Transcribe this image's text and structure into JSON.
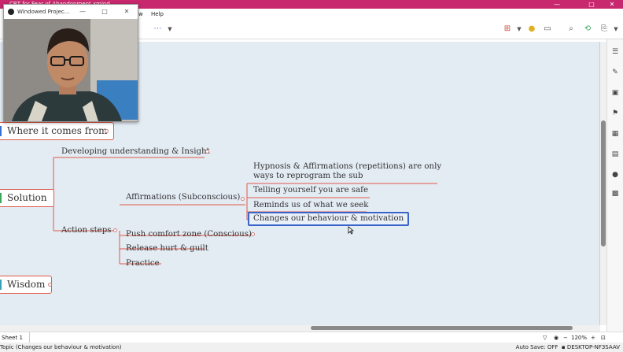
{
  "window": {
    "title": "CBT for Fear of Abandonment.xmind",
    "minimize": "—",
    "maximize": "□",
    "close": "✕"
  },
  "menu": {
    "view": "w",
    "help": "Help"
  },
  "webcam": {
    "title": "Windowed Projec...",
    "minimize": "—",
    "maximize": "□",
    "close": "✕"
  },
  "mindmap": {
    "where_it_comes_from": "Where it comes from",
    "solution": "Solution",
    "wisdom": "Wisdom",
    "developing": "Developing understanding & Insight",
    "action_steps": "Action steps",
    "affirmations": "Affirmations (Subconscious)",
    "hypnosis": "Hypnosis & Affirmations (repetitions) are only ways to reprogram the sub",
    "telling_yourself": "Telling yourself you are safe",
    "reminds_us": "Reminds us of what we seek",
    "changes_behaviour": "Changes our behaviour & motivation",
    "push_comfort": "Push comfort zone (Conscious)",
    "release_hurt": "Release hurt & guilt",
    "practice": "Practice"
  },
  "sheet": {
    "tab": "Sheet 1",
    "zoom": "120%"
  },
  "status": {
    "topic": "Topic (Changes our behaviour & motivation)",
    "autosave": "Auto Save: OFF",
    "computer": "DESKTOP-NF3SAAV"
  },
  "colors": {
    "titlebar": "#c8286e",
    "branch_line": "#e05a48",
    "canvas": "#e3ebf3",
    "selection": "#3b64c8",
    "bar_blue": "#3a6fd8",
    "bar_green": "#3ba85a",
    "bar_teal": "#3aa0b8"
  }
}
